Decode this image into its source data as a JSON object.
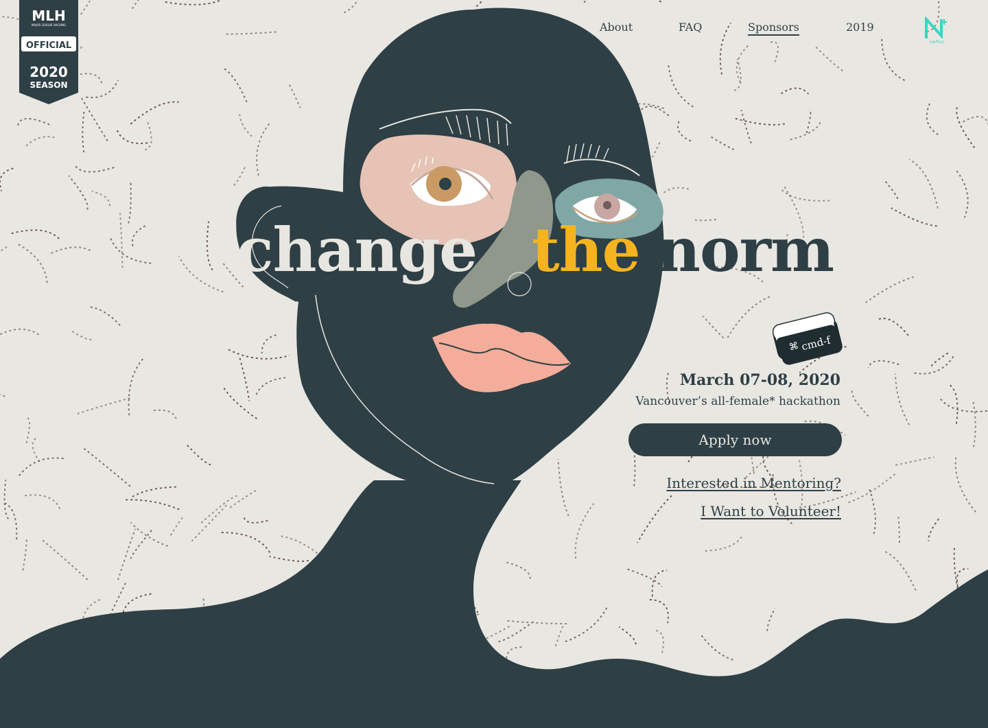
{
  "badge": {
    "brand": "MLH",
    "subtitle": "MAJOR LEAGUE HACKING",
    "official": "OFFICIAL",
    "year": "2020",
    "season": "SEASON"
  },
  "nav": {
    "items": [
      {
        "label": "About"
      },
      {
        "label": "FAQ"
      },
      {
        "label": "Sponsors",
        "active": true
      },
      {
        "label": "2019"
      }
    ]
  },
  "org_logo": {
    "icon": "nwplus-logo-icon",
    "label": "nwPlus"
  },
  "headline": {
    "word1": "change",
    "word2": "the",
    "word3": "norm"
  },
  "key": {
    "symbol": "⌘",
    "label": "cmd-f"
  },
  "event": {
    "date": "March 07-08, 2020",
    "tagline": "Vancouver’s all-female* hackathon"
  },
  "cta": {
    "apply": "Apply now",
    "mentor": "Interested in Mentoring?",
    "volunteer": "I Want to Volunteer!"
  },
  "colors": {
    "background": "#e9e7e2",
    "dark": "#2e3f45",
    "accent": "#f5b41f",
    "teal": "#37d6c0"
  }
}
